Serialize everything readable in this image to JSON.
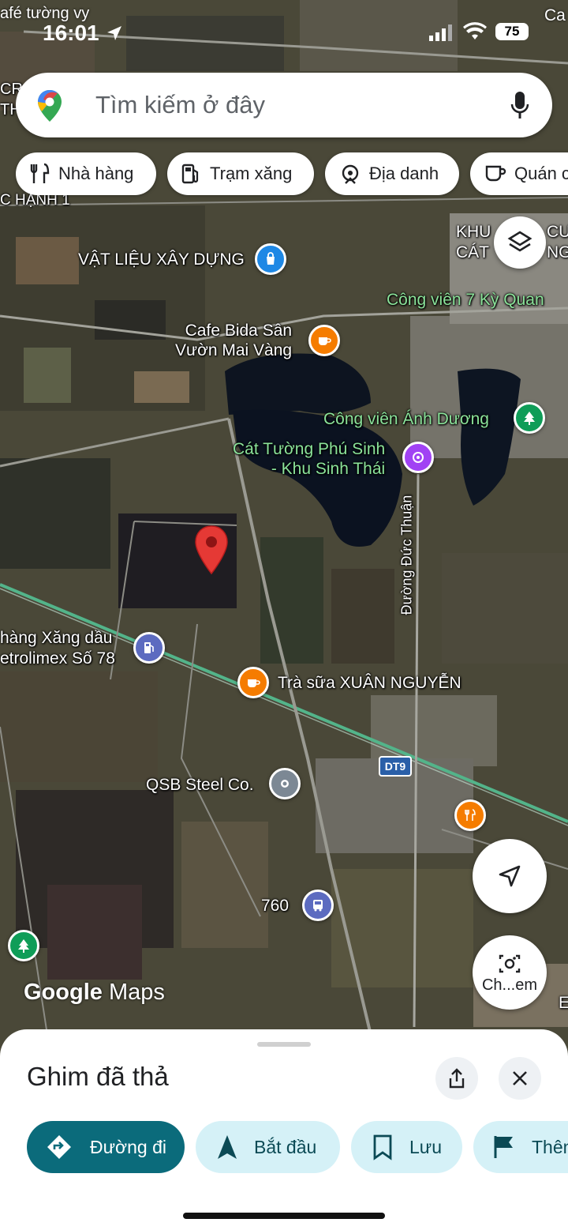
{
  "status_bar": {
    "time": "16:01",
    "battery": "75",
    "top_left_label": "afé tường vy",
    "top_right_label": "Ca"
  },
  "search": {
    "placeholder": "Tìm kiếm ở đây"
  },
  "chips": [
    {
      "label": "Nhà hàng",
      "icon": "fork-knife-icon"
    },
    {
      "label": "Trạm xăng",
      "icon": "fuel-pump-icon"
    },
    {
      "label": "Địa danh",
      "icon": "landmark-icon"
    },
    {
      "label": "Quán c",
      "icon": "coffee-cup-icon"
    }
  ],
  "map_labels": {
    "cr_th": "CR\nTH",
    "c_hanh": "C HẠNH 1",
    "vat_lieu": "VẬT LIỆU XÂY DỰNG",
    "khu_cat": "KHU\nCÁT",
    "cu_ng": "CU\nNG",
    "cong_vien_7": "Công viên 7 Kỳ Quan",
    "cafe_bida": "Cafe Bida Sân\nVườn Mai Vàng",
    "cong_vien_anh_duong": "Công viên Ánh Dương",
    "cat_tuong": "Cát Tường Phú Sinh\n- Khu Sinh Thái",
    "duong_duc_thuan": "Đường Đức Thuận",
    "xang_dau": "hàng Xăng dầu\netrolimex Số 78",
    "tra_sua": "Trà sữa XUÂN NGUYỄN",
    "dt9": "DT9",
    "qsb": "QSB Steel Co.",
    "bus_760": "760",
    "e_right": "E"
  },
  "watermark": {
    "google": "Google",
    "maps": "Maps"
  },
  "fabs": {
    "lens_label": "Ch...em"
  },
  "sheet": {
    "title": "Ghim đã thả",
    "buttons": [
      {
        "label": "Đường đi",
        "icon": "directions-icon"
      },
      {
        "label": "Bắt đầu",
        "icon": "navigation-arrow-icon"
      },
      {
        "label": "Lưu",
        "icon": "bookmark-icon"
      },
      {
        "label": "Thêm",
        "icon": "flag-icon"
      }
    ]
  },
  "colors": {
    "primary_button": "#0b6b7b",
    "secondary_button": "#d5f1f7",
    "pin_red": "#e53935",
    "poi_orange": "#f57c00",
    "poi_blue": "#1e88e5",
    "poi_green": "#0f9d58",
    "poi_purple": "#a142f4",
    "poi_indigo": "#5c6bc0",
    "poi_gray": "#7c8894"
  }
}
